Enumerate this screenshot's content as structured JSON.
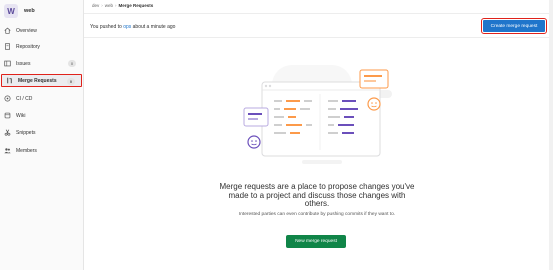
{
  "project": {
    "avatar_letter": "W",
    "name": "web"
  },
  "sidebar": {
    "items": [
      {
        "label": "Overview",
        "icon": "home-icon"
      },
      {
        "label": "Repository",
        "icon": "doc-icon"
      },
      {
        "label": "Issues",
        "icon": "issues-icon",
        "badge": "0"
      },
      {
        "label": "Merge Requests",
        "icon": "merge-request-icon",
        "badge": "0",
        "active": true
      },
      {
        "label": "CI / CD",
        "icon": "rocket-icon"
      },
      {
        "label": "Wiki",
        "icon": "book-icon"
      },
      {
        "label": "Snippets",
        "icon": "scissors-icon"
      },
      {
        "label": "Members",
        "icon": "users-icon"
      }
    ]
  },
  "breadcrumb": {
    "group": "dev",
    "project": "web",
    "current": "Merge Requests"
  },
  "banner": {
    "prefix": "You pushed to ",
    "branch": "ops",
    "suffix": " about a minute ago",
    "button": "Create merge request"
  },
  "empty_state": {
    "title": "Merge requests are a place to propose changes you've made to a project and discuss those changes with others.",
    "description": "Interested parties can even contribute by pushing commits if they want to.",
    "button": "New merge request"
  },
  "colors": {
    "accent": "#1f75cb",
    "success": "#108548",
    "highlight": "#e0221b",
    "illustration_orange": "#fc9a4a",
    "illustration_purple": "#6b4fbb"
  }
}
